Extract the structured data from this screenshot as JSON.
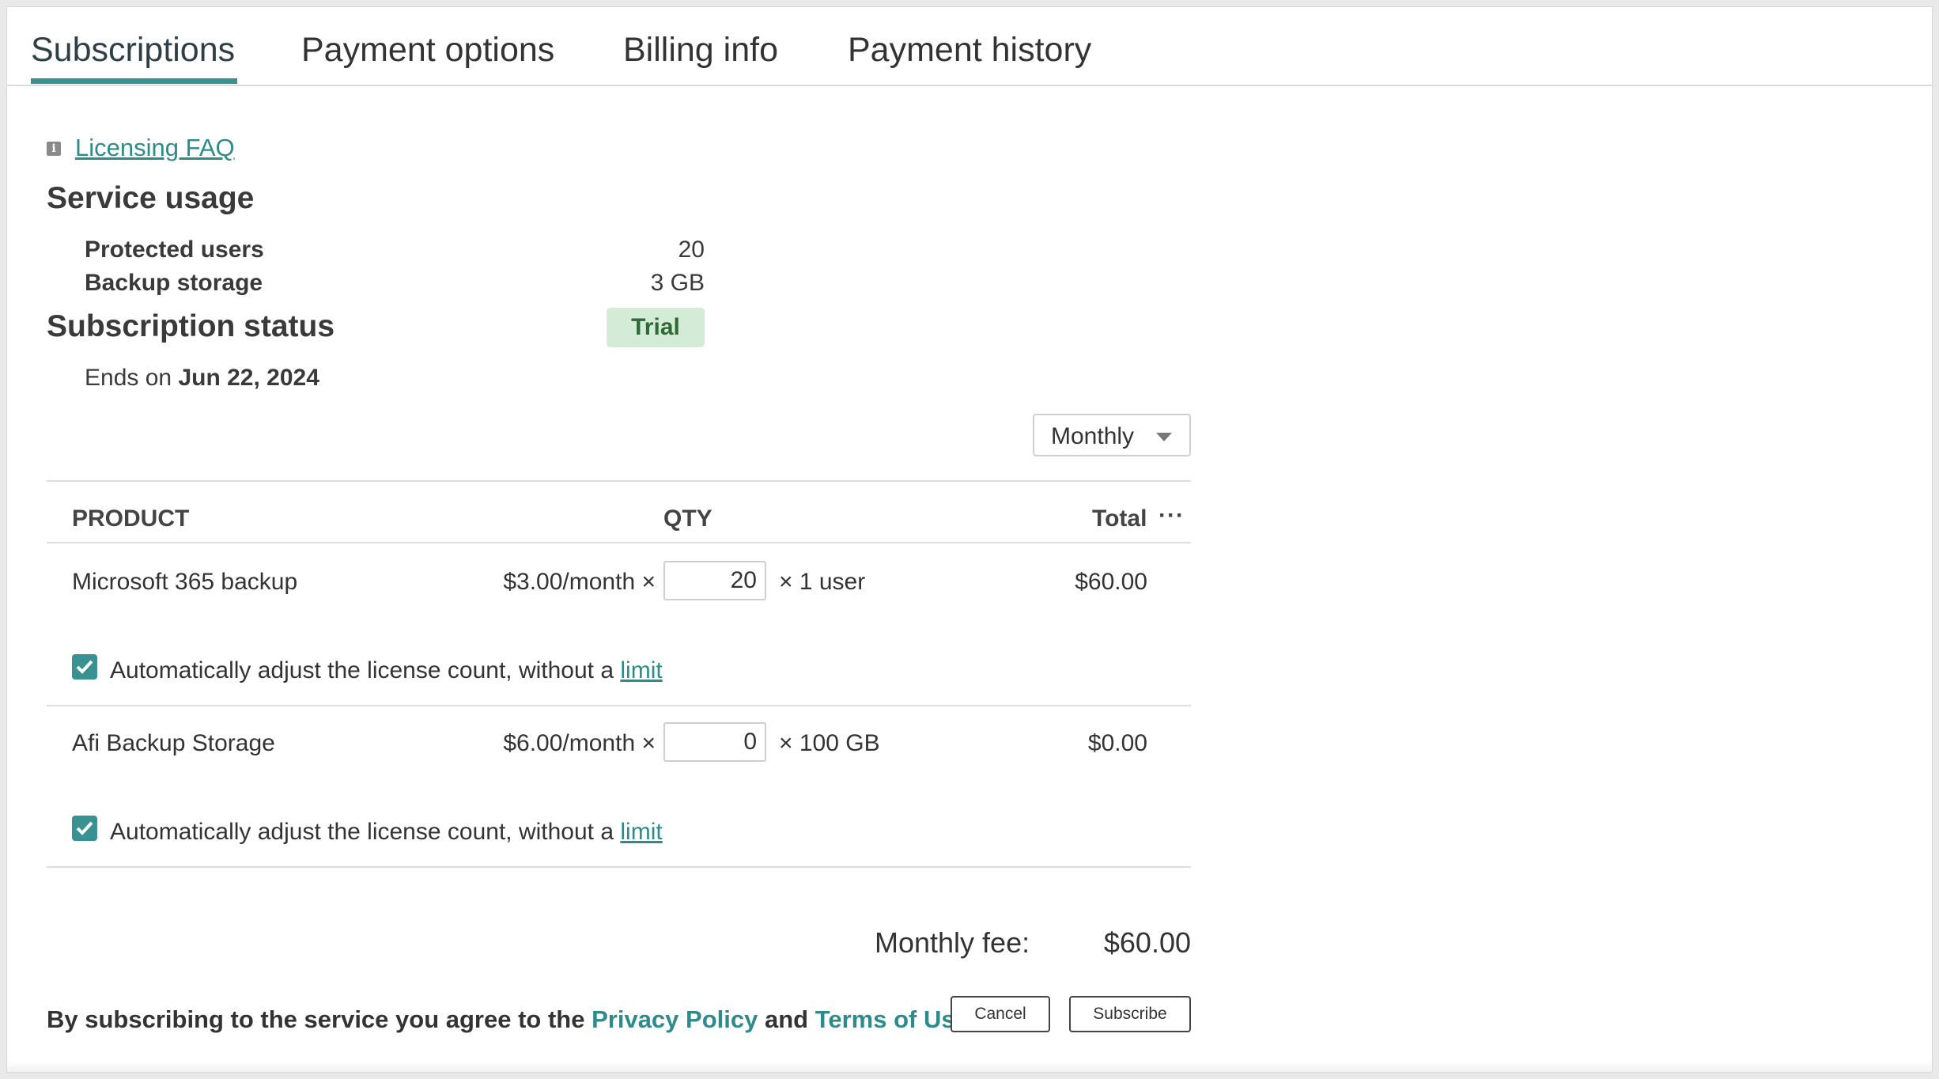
{
  "tabs": [
    {
      "label": "Subscriptions",
      "active": true
    },
    {
      "label": "Payment options",
      "active": false
    },
    {
      "label": "Billing info",
      "active": false
    },
    {
      "label": "Payment history",
      "active": false
    }
  ],
  "faq_link": "Licensing FAQ",
  "service_usage": {
    "title": "Service usage",
    "rows": [
      {
        "label": "Protected users",
        "value": "20"
      },
      {
        "label": "Backup storage",
        "value": "3 GB"
      }
    ]
  },
  "subscription_status": {
    "title": "Subscription status",
    "badge": "Trial",
    "ends_prefix": "Ends on",
    "ends_date": "Jun 22, 2024"
  },
  "billing_period": {
    "selected": "Monthly"
  },
  "table": {
    "headers": {
      "product": "PRODUCT",
      "qty": "QTY",
      "total": "Total"
    },
    "rows": [
      {
        "product": "Microsoft 365 backup",
        "price": "$3.00/month ×",
        "qty": "20",
        "unit": "× 1 user",
        "total": "$60.00",
        "auto_adjust_text": "Automatically adjust the license count, without a",
        "auto_adjust_link": "limit",
        "auto_adjust_checked": true
      },
      {
        "product": "Afi Backup Storage",
        "price": "$6.00/month ×",
        "qty": "0",
        "unit": "× 100 GB",
        "total": "$0.00",
        "auto_adjust_text": "Automatically adjust the license count, without a",
        "auto_adjust_link": "limit",
        "auto_adjust_checked": true
      }
    ]
  },
  "fee": {
    "label": "Monthly fee:",
    "value": "$60.00"
  },
  "legal": {
    "prefix": "By subscribing to the service you agree to the",
    "privacy": "Privacy Policy",
    "and": "and",
    "terms": "Terms of Use"
  },
  "buttons": {
    "cancel": "Cancel",
    "subscribe": "Subscribe"
  },
  "colors": {
    "accent": "#3a9191",
    "link": "#2e8b8b",
    "trial_bg": "#d4ecd7",
    "trial_text": "#2d6a36"
  }
}
